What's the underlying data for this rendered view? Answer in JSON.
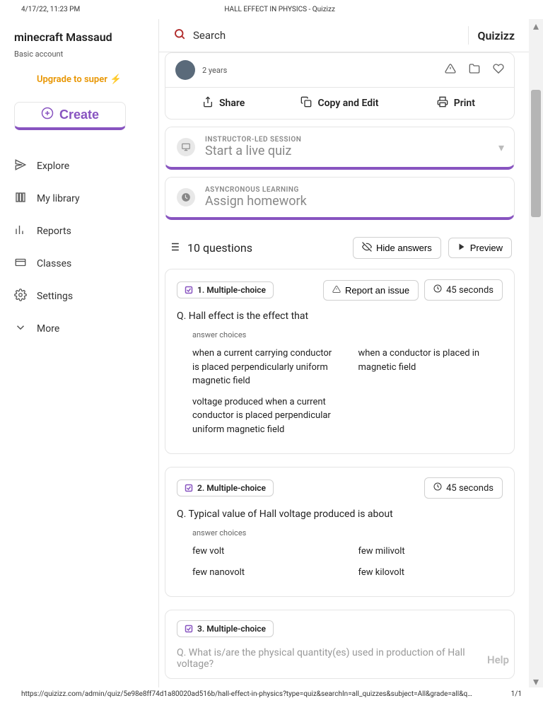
{
  "print": {
    "datetime": "4/17/22, 11:23 PM",
    "title": "HALL EFFECT IN PHYSICS - Quizizz"
  },
  "footer": {
    "url": "https://quizizz.com/admin/quiz/5e98e8ff74d1a80020ad516b/hall-effect-in-physics?type=quiz&searchIn=all_quizzes&subject=All&grade=all&queryId=6…",
    "page": "1/1"
  },
  "sidebar": {
    "username": "minecraft Massaud",
    "account": "Basic account",
    "upgrade": "Upgrade to super",
    "create": "Create",
    "items": [
      {
        "label": "Explore"
      },
      {
        "label": "My library"
      },
      {
        "label": "Reports"
      },
      {
        "label": "Classes"
      },
      {
        "label": "Settings"
      },
      {
        "label": "More"
      }
    ]
  },
  "header": {
    "search": "Search",
    "brand": "Quizizz"
  },
  "quiz": {
    "years": "2 years",
    "actions": {
      "share": "Share",
      "copy": "Copy and Edit",
      "print": "Print"
    }
  },
  "modes": {
    "live": {
      "tiny": "INSTRUCTOR-LED SESSION",
      "label": "Start a live quiz"
    },
    "hw": {
      "tiny": "ASYNCRONOUS LEARNING",
      "label": "Assign homework"
    }
  },
  "list": {
    "count": "10 questions",
    "hide": "Hide answers",
    "preview": "Preview"
  },
  "questions": [
    {
      "type": "1. Multiple-choice",
      "report": "Report an issue",
      "time": "45 seconds",
      "q": "Q. Hall effect is the effect that",
      "ac": "answer choices",
      "choices": [
        "when a current carrying conductor is placed perpendicularly uniform magnetic field",
        "when a conductor is placed in magnetic field",
        "voltage produced when a current conductor is placed perpendicular uniform magnetic field",
        ""
      ]
    },
    {
      "type": "2. Multiple-choice",
      "time": "45 seconds",
      "q": "Q. Typical value of Hall voltage produced is about",
      "ac": "answer choices",
      "choices": [
        "few volt",
        "few milivolt",
        "few nanovolt",
        "few kilovolt"
      ]
    },
    {
      "type": "3. Multiple-choice",
      "q": "Q. What is/are the physical quantity(es) used in production of Hall voltage?"
    }
  ],
  "help": "Help"
}
